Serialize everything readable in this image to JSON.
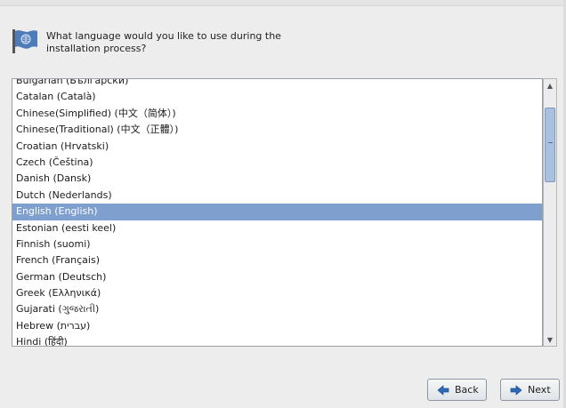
{
  "header": {
    "title": "What language would you like to use during the installation process?",
    "icon": "flag-icon"
  },
  "language_list": {
    "items": [
      "Bulgarian (Български)",
      "Catalan (Català)",
      "Chinese(Simplified) (中文（简体）)",
      "Chinese(Traditional) (中文（正體）)",
      "Croatian (Hrvatski)",
      "Czech (Čeština)",
      "Danish (Dansk)",
      "Dutch (Nederlands)",
      "English (English)",
      "Estonian (eesti keel)",
      "Finnish (suomi)",
      "French (Français)",
      "German (Deutsch)",
      "Greek (Ελληνικά)",
      "Gujarati (ગુજરાતી)",
      "Hebrew (עברית)",
      "Hindi (हिंदी)"
    ],
    "selected": "English (English)",
    "selection_color": "#7f9fcf"
  },
  "buttons": {
    "back": "Back",
    "next": "Next",
    "back_icon": "arrow-left-icon",
    "next_icon": "arrow-right-icon"
  }
}
